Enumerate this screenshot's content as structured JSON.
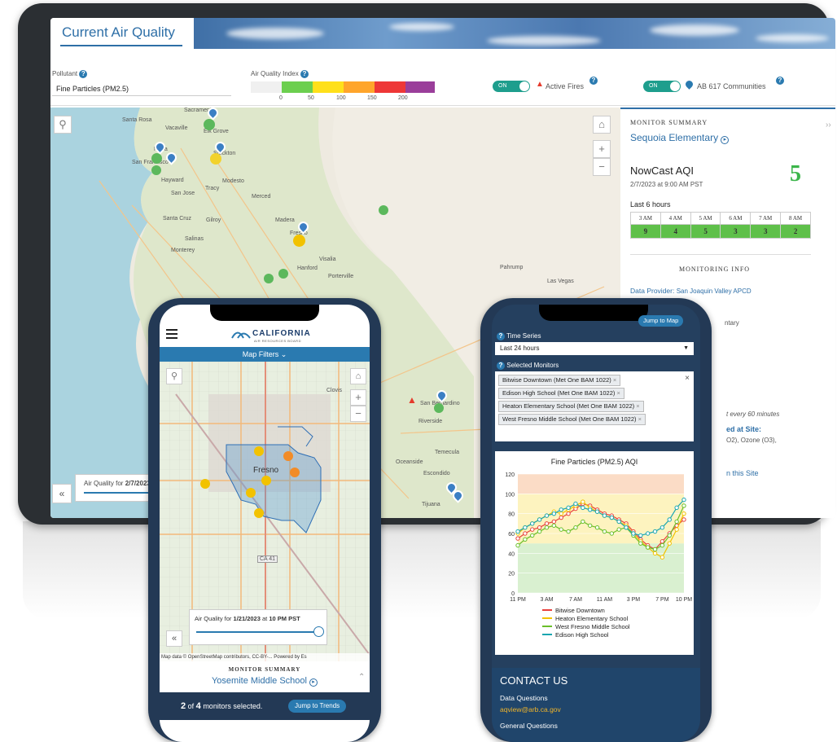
{
  "desktop": {
    "title": "Current Air Quality",
    "pollutant": {
      "label": "Pollutant",
      "value": "Fine Particles (PM2.5)"
    },
    "aqi": {
      "label": "Air Quality Index",
      "ticks": [
        "0",
        "50",
        "100",
        "150",
        "200"
      ],
      "colors": [
        "#6ccf4f",
        "#ffe01a",
        "#ffa52b",
        "#ee3737",
        "#9a3e9a"
      ]
    },
    "toggles": [
      {
        "state": "ON",
        "label": "Active Fires"
      },
      {
        "state": "ON",
        "label": "AB 617 Communities"
      }
    ],
    "map_labels": [
      "Sacramento",
      "Santa Rosa",
      "Vacaville",
      "Elk Grove",
      "Napa",
      "Stockton",
      "San Francisco",
      "Hayward",
      "Tracy",
      "Modesto",
      "San Jose",
      "Merced",
      "Santa Cruz",
      "Gilroy",
      "Madera",
      "Fresno",
      "Salinas",
      "Monterey",
      "Visalia",
      "Hanford",
      "Porterville",
      "Pahrump",
      "Las Vegas",
      "San Bernardino",
      "Riverside",
      "Temecula",
      "Oceanside",
      "Escondido",
      "Tijuana"
    ],
    "air_quality_for": {
      "label": "Air Quality for",
      "date": "2/7/2023"
    },
    "monitor_summary": {
      "heading": "MONITOR SUMMARY",
      "site": "Sequoia Elementary",
      "nowcast_label": "NowCast AQI",
      "timestamp": "2/7/2023 at 9:00 AM PST",
      "value": "5",
      "last_hours_label": "Last 6 hours",
      "hours": [
        "3 AM",
        "4 AM",
        "5 AM",
        "6 AM",
        "7 AM",
        "8 AM"
      ],
      "hour_values": [
        "9",
        "4",
        "5",
        "3",
        "3",
        "2"
      ],
      "info_heading": "MONITORING INFO",
      "provider_label": "Data Provider:",
      "provider": "San Joaquin Valley APCD",
      "partial": [
        "ntary",
        "t every 60 minutes",
        "ed at Site:",
        "O2), Ozone (O3),",
        "n this Site"
      ]
    }
  },
  "phone_left": {
    "brand": "CALIFORNIA",
    "brand_sub": "AIR RESOURCES BOARD",
    "filters_label": "Map Filters",
    "map_labels": [
      "Clovis",
      "Fresno",
      "CA 41"
    ],
    "air_quality_for": {
      "label": "Air Quality for",
      "date": "1/21/2023",
      "at": "at",
      "time": "10 PM PST"
    },
    "attribution": "Map data © OpenStreetMap contributors, CC-BY-...   Powered by Es",
    "monitor_summary_heading": "MONITOR SUMMARY",
    "site": "Yosemite Middle School",
    "selected_count": "2",
    "of_text": "of",
    "total_count": "4",
    "selected_suffix": "monitors selected.",
    "trends_button": "Jump to Trends"
  },
  "phone_right": {
    "jump_button": "Jump to Map",
    "time_series_label": "Time Series",
    "time_series_value": "Last 24 hours",
    "selected_monitors_label": "Selected Monitors",
    "monitors": [
      "Bitwise Downtown (Met One BAM 1022)",
      "Edison High School (Met One BAM 1022)",
      "Heaton Elementary School (Met One BAM 1022)",
      "West Fresno Middle School (Met One BAM 1022)"
    ],
    "contact_heading": "CONTACT US",
    "data_questions": "Data Questions",
    "email": "aqview@arb.ca.gov",
    "general_questions": "General Questions"
  },
  "chart_data": {
    "type": "line",
    "title": "Fine Particles (PM2.5) AQI",
    "x": [
      "11 PM",
      "12 AM",
      "1 AM",
      "2 AM",
      "3 AM",
      "4 AM",
      "5 AM",
      "6 AM",
      "7 AM",
      "8 AM",
      "9 AM",
      "10 AM",
      "11 AM",
      "12 PM",
      "1 PM",
      "2 PM",
      "3 PM",
      "4 PM",
      "5 PM",
      "6 PM",
      "7 PM",
      "8 PM",
      "9 PM",
      "10 PM"
    ],
    "xticks": [
      "11 PM",
      "3 AM",
      "7 AM",
      "11 AM",
      "3 PM",
      "7 PM",
      "10 PM"
    ],
    "ylim": [
      0,
      120
    ],
    "yticks": [
      0,
      10,
      20,
      30,
      40,
      50,
      60,
      70,
      80,
      90,
      100,
      110,
      120
    ],
    "bands": [
      {
        "from": 0,
        "to": 50,
        "color": "#d9f0d0"
      },
      {
        "from": 50,
        "to": 100,
        "color": "#fdf3bf"
      },
      {
        "from": 100,
        "to": 120,
        "color": "#fbdcc6"
      }
    ],
    "series": [
      {
        "name": "Bitwise Downtown",
        "color": "#e8413c",
        "values": [
          55,
          60,
          64,
          66,
          70,
          72,
          76,
          80,
          85,
          90,
          88,
          84,
          80,
          78,
          74,
          70,
          62,
          54,
          48,
          44,
          52,
          60,
          68,
          74
        ]
      },
      {
        "name": "Heaton Elementary School",
        "color": "#f2c200",
        "values": [
          60,
          66,
          70,
          74,
          78,
          82,
          80,
          84,
          88,
          92,
          86,
          82,
          78,
          76,
          72,
          68,
          60,
          52,
          46,
          40,
          36,
          50,
          64,
          80
        ]
      },
      {
        "name": "West Fresno Middle School",
        "color": "#6abf2a",
        "values": [
          48,
          54,
          58,
          62,
          66,
          68,
          64,
          62,
          66,
          72,
          68,
          66,
          62,
          60,
          64,
          66,
          58,
          50,
          46,
          44,
          48,
          58,
          72,
          88
        ]
      },
      {
        "name": "Edison High School",
        "color": "#1aa6b0",
        "values": [
          62,
          66,
          70,
          74,
          78,
          80,
          84,
          86,
          90,
          86,
          84,
          82,
          78,
          76,
          72,
          66,
          60,
          58,
          60,
          62,
          66,
          74,
          86,
          94
        ]
      }
    ]
  }
}
